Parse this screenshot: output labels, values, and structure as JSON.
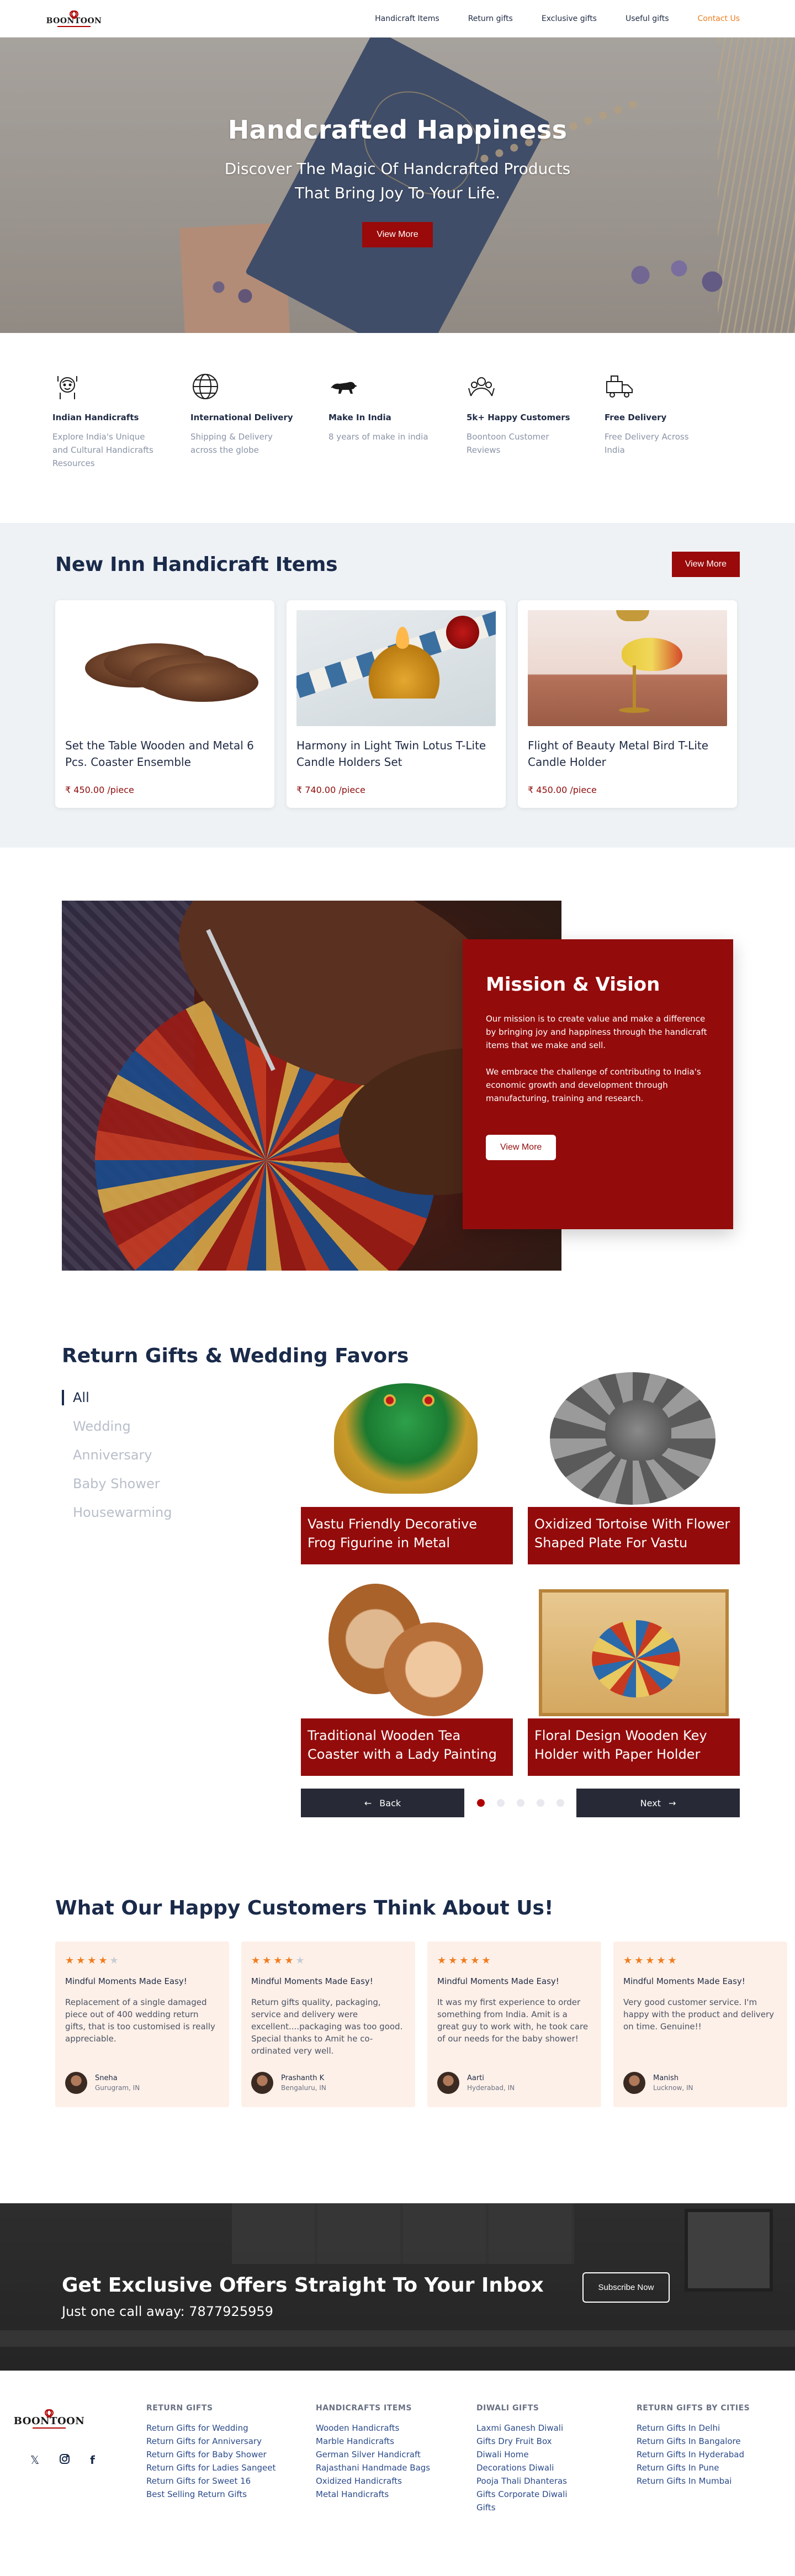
{
  "nav": {
    "logo": "BOONTOON",
    "links": [
      "Handicraft Items",
      "Return gifts",
      "Exclusive gifts",
      "Useful gifts",
      "Contact Us"
    ]
  },
  "hero": {
    "title": "Handcrafted Happiness",
    "subtitle_line1": "Discover The Magic Of Handcrafted Products",
    "subtitle_line2": "That Bring Joy To Your Life.",
    "cta": "View More"
  },
  "features": [
    {
      "icon": "handicraft-icon",
      "title": "Indian Handicrafts",
      "desc": "Explore India's Unique and Cultural Handicrafts Resources"
    },
    {
      "icon": "globe-icon",
      "title": "International Delivery",
      "desc": "Shipping & Delivery across the globe"
    },
    {
      "icon": "lion-icon",
      "title": "Make In India",
      "desc": "8 years of make in india"
    },
    {
      "icon": "happy-customers-icon",
      "title": "5k+ Happy Customers",
      "desc": "Boontoon Customer Reviews"
    },
    {
      "icon": "delivery-truck-icon",
      "title": "Free Delivery",
      "desc": "Free Delivery Across India"
    }
  ],
  "new_inn": {
    "title": "New Inn Handicraft Items",
    "cta": "View More",
    "products": [
      {
        "title": "Set the Table Wooden and Metal 6 Pcs. Coaster Ensemble",
        "price": "₹ 450.00 /piece"
      },
      {
        "title": "Harmony in Light Twin Lotus T-Lite Candle Holders Set",
        "price": "₹ 740.00 /piece"
      },
      {
        "title": "Flight of Beauty Metal Bird T-Lite Candle Holder",
        "price": "₹ 450.00 /piece"
      }
    ]
  },
  "mission": {
    "title": "Mission & Vision",
    "para1": "Our mission is to create value and make a difference by bringing joy and happiness through the handicraft items that we make and sell.",
    "para2": "We embrace the challenge of contributing to India's economic growth and development through manufacturing, training and research.",
    "cta": "View More"
  },
  "gifts": {
    "title": "Return Gifts & Wedding Favors",
    "tabs": [
      "All",
      "Wedding",
      "Anniversary",
      "Baby Shower",
      "Housewarming"
    ],
    "items": [
      {
        "label": "Vastu Friendly Decorative Frog Figurine in Metal"
      },
      {
        "label": "Oxidized Tortoise With Flower Shaped Plate For Vastu"
      },
      {
        "label": "Traditional Wooden Tea Coaster with a Lady Painting"
      },
      {
        "label": "Floral Design Wooden Key Holder with Paper Holder"
      }
    ],
    "back": "Back",
    "next": "Next",
    "dots": 5,
    "active_dot": 1
  },
  "testimonials": {
    "title": "What Our Happy Customers Think About Us!",
    "items": [
      {
        "stars": 4,
        "heading": "Mindful Moments Made Easy!",
        "text": "Replacement of a single damaged piece out of 400 wedding return gifts, that is too customised is really appreciable.",
        "name": "Sneha",
        "location": "Gurugram, IN"
      },
      {
        "stars": 4,
        "heading": "Mindful Moments Made Easy!",
        "text": "Return gifts quality, packaging, service and delivery were excellent....packaging was too good. Special thanks to Amit he co-ordinated very well.",
        "name": "Prashanth K",
        "location": "Bengaluru, IN"
      },
      {
        "stars": 5,
        "heading": "Mindful Moments Made Easy!",
        "text": "It was my first experience to order something from India. Amit is a great guy to work with, he took care of our needs for the baby shower!",
        "name": "Aarti",
        "location": "Hyderabad, IN"
      },
      {
        "stars": 5,
        "heading": "Mindful Moments Made Easy!",
        "text": "Very good customer service. I'm happy with the product and delivery on time. Genuine!!",
        "name": "Manish",
        "location": "Lucknow, IN"
      }
    ]
  },
  "newsletter": {
    "title": "Get Exclusive Offers Straight To Your Inbox",
    "phone": "Just one call away: 7877925959",
    "cta": "Subscribe Now"
  },
  "footer": {
    "logo": "BOONTOON",
    "socials": [
      "x-icon",
      "instagram-icon",
      "facebook-icon"
    ],
    "columns": [
      {
        "title": "RETURN GIFTS",
        "links": [
          "Return Gifts for Wedding",
          "Return Gifts for Anniversary",
          "Return Gifts for Baby Shower",
          "Return Gifts for Ladies Sangeet",
          "Return Gifts for Sweet 16",
          "Best Selling Return Gifts"
        ]
      },
      {
        "title": "HANDICRAFTS ITEMS",
        "links": [
          "Wooden Handicrafts",
          "Marble Handicrafts",
          "German Silver Handicraft",
          "Rajasthani Handmade Bags",
          "Oxidized Handicrafts",
          "Metal Handicrafts"
        ]
      },
      {
        "title": "DIWALI GIFTS",
        "links": [
          "Laxmi Ganesh Diwali",
          "Gifts Dry Fruit Box",
          "Diwali Home",
          "Decorations Diwali",
          "Pooja Thali Dhanteras",
          "Gifts Corporate Diwali",
          "Gifts"
        ]
      },
      {
        "title": "RETURN GIFTS BY CITIES",
        "links": [
          "Return Gifts In Delhi",
          "Return Gifts In Bangalore",
          "Return Gifts In Hyderabad",
          "Return Gifts In Pune",
          "Return Gifts In Mumbai"
        ]
      }
    ]
  }
}
